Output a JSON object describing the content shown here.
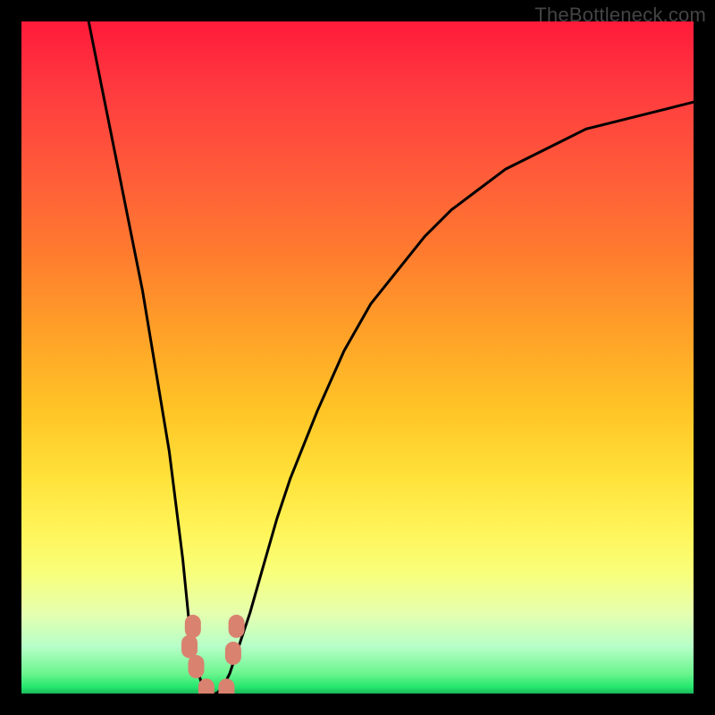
{
  "watermark": "TheBottleneck.com",
  "chart_data": {
    "type": "line",
    "title": "",
    "xlabel": "",
    "ylabel": "",
    "xlim": [
      0,
      100
    ],
    "ylim": [
      0,
      100
    ],
    "grid": false,
    "series": [
      {
        "name": "bottleneck-curve",
        "x": [
          10,
          12,
          14,
          16,
          18,
          20,
          22,
          24,
          25,
          26,
          27,
          28,
          29,
          30,
          31,
          32,
          34,
          36,
          38,
          40,
          44,
          48,
          52,
          56,
          60,
          64,
          68,
          72,
          76,
          80,
          84,
          88,
          92,
          96,
          100
        ],
        "values": [
          100,
          90,
          80,
          70,
          60,
          48,
          36,
          20,
          10,
          4,
          1,
          0,
          0,
          1,
          3,
          6,
          12,
          19,
          26,
          32,
          42,
          51,
          58,
          63,
          68,
          72,
          75,
          78,
          80,
          82,
          84,
          85,
          86,
          87,
          88
        ]
      }
    ],
    "markers": [
      {
        "name": "left-cluster-top",
        "x": 25.5,
        "y": 10,
        "color": "#d9826f"
      },
      {
        "name": "left-cluster-mid",
        "x": 25.0,
        "y": 7,
        "color": "#d9826f"
      },
      {
        "name": "left-cluster-low",
        "x": 26.0,
        "y": 4,
        "color": "#d9826f"
      },
      {
        "name": "trough-left",
        "x": 27.5,
        "y": 0.5,
        "color": "#d9826f"
      },
      {
        "name": "trough-right",
        "x": 30.5,
        "y": 0.5,
        "color": "#d9826f"
      },
      {
        "name": "right-cluster-low",
        "x": 31.5,
        "y": 6,
        "color": "#d9826f"
      },
      {
        "name": "right-cluster-top",
        "x": 32.0,
        "y": 10,
        "color": "#d9826f"
      }
    ],
    "colors": {
      "curve": "#000000",
      "marker": "#d9826f",
      "gradient_top": "#ff1a3a",
      "gradient_bottom": "#1ab85a"
    }
  }
}
